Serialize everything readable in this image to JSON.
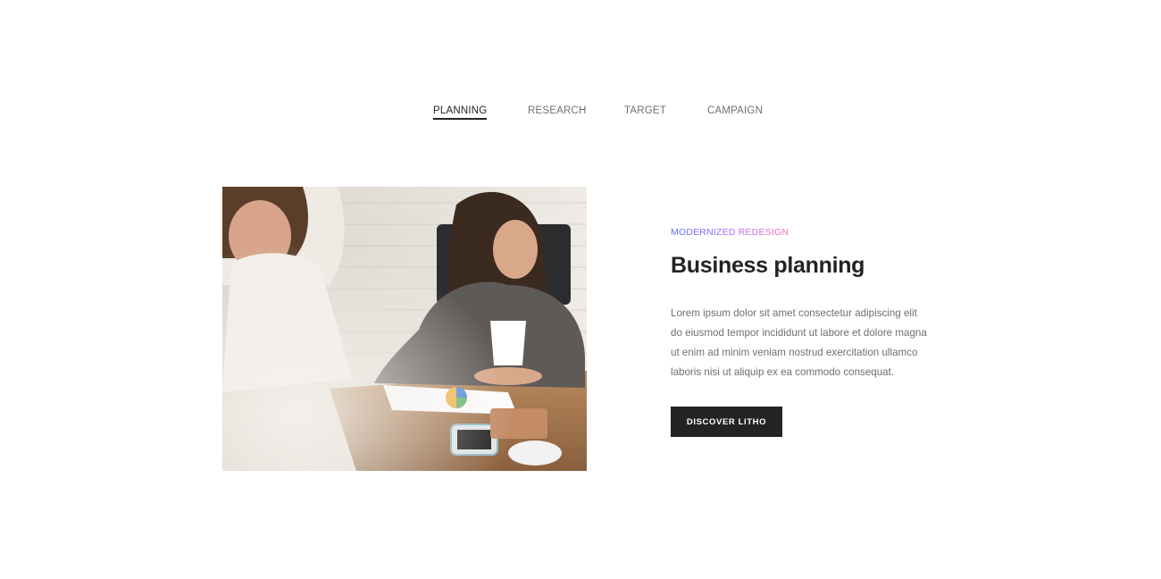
{
  "tabs": [
    {
      "label": "PLANNING",
      "active": true
    },
    {
      "label": "RESEARCH",
      "active": false
    },
    {
      "label": "TARGET",
      "active": false
    },
    {
      "label": "CAMPAIGN",
      "active": false
    }
  ],
  "content": {
    "eyebrow": "MODERNIZED REDESIGN",
    "title": "Business planning",
    "description": "Lorem ipsum dolor sit amet consectetur adipiscing elit do eiusmod tempor incididunt ut labore et dolore magna ut enim ad minim veniam nostrud exercitation ullamco laboris nisi ut aliquip ex ea commodo consequat.",
    "button_label": "DISCOVER LITHO"
  },
  "colors": {
    "text_dark": "#232323",
    "text_muted": "#6f6f6f",
    "gradient_start": "#5a6bff",
    "gradient_end": "#ff6fa3",
    "button_bg": "#232323"
  },
  "image": {
    "subject": "business-meeting-photo"
  }
}
